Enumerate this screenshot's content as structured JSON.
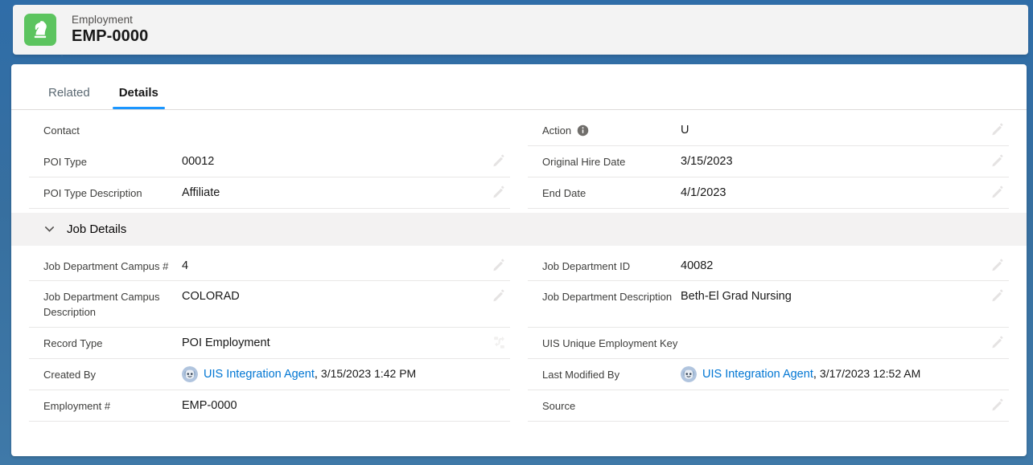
{
  "theme": {
    "background_blue": "#2f6da8",
    "accent_blue": "#1b96ff",
    "link_blue": "#0176d3",
    "icon_green": "#5cc45f",
    "section_bg": "#f3f2f2"
  },
  "header": {
    "icon_name": "employment-knight-icon",
    "object_label": "Employment",
    "record_name": "EMP-0000"
  },
  "tabs": [
    {
      "label": "Related",
      "active": false
    },
    {
      "label": "Details",
      "active": true
    }
  ],
  "top_section": {
    "rows": [
      {
        "left": {
          "label": "Contact",
          "value": "",
          "editable": false,
          "rule": false,
          "info": false
        },
        "right": {
          "label": "Action",
          "value": "U",
          "editable": true,
          "rule": true,
          "info": true
        }
      },
      {
        "left": {
          "label": "POI Type",
          "value": "00012",
          "editable": true,
          "rule": true,
          "info": false
        },
        "right": {
          "label": "Original Hire Date",
          "value": "3/15/2023",
          "editable": true,
          "rule": true,
          "info": false
        }
      },
      {
        "left": {
          "label": "POI Type Description",
          "value": "Affiliate",
          "editable": true,
          "rule": true,
          "info": false
        },
        "right": {
          "label": "End Date",
          "value": "4/1/2023",
          "editable": true,
          "rule": true,
          "info": false
        }
      }
    ]
  },
  "job_details_section": {
    "title": "Job Details",
    "expanded": true,
    "chevron_icon": "chevron-down-icon",
    "rows": [
      {
        "left": {
          "label": "Job Department Campus #",
          "value": "4",
          "editable": true,
          "rule": true,
          "info": false
        },
        "right": {
          "label": "Job Department ID",
          "value": "40082",
          "editable": true,
          "rule": true,
          "info": false
        }
      },
      {
        "left": {
          "label": "Job Department Campus Description",
          "value": "COLORAD",
          "editable": true,
          "rule": true,
          "info": false
        },
        "right": {
          "label": "Job Department Description",
          "value": "Beth-El Grad Nursing",
          "editable": true,
          "rule": true,
          "info": false
        }
      },
      {
        "left": {
          "label": "Record Type",
          "value": "POI Employment",
          "editable": true,
          "edit_icon": "change-record-type-icon",
          "rule": true,
          "info": false
        },
        "right": {
          "label": "UIS Unique Employment Key",
          "value": "",
          "editable": true,
          "rule": true,
          "info": false
        }
      }
    ],
    "audit_rows": [
      {
        "left": {
          "label": "Created By",
          "user": "UIS Integration Agent",
          "timestamp": "3/15/2023 1:42 PM",
          "avatar_icon": "bot-avatar-icon",
          "editable": false,
          "rule": true
        },
        "right": {
          "label": "Last Modified By",
          "user": "UIS Integration Agent",
          "timestamp": "3/17/2023 12:52 AM",
          "avatar_icon": "bot-avatar-icon",
          "editable": false,
          "rule": true
        }
      },
      {
        "left": {
          "label": "Employment #",
          "value": "EMP-0000",
          "editable": false,
          "rule": true,
          "info": false
        },
        "right": {
          "label": "Source",
          "value": "",
          "editable": true,
          "rule": true,
          "info": false
        }
      }
    ]
  }
}
